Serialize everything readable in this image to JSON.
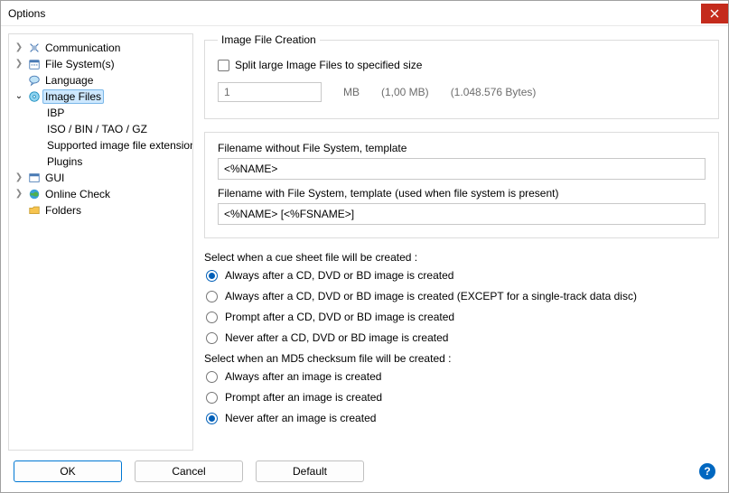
{
  "window": {
    "title": "Options"
  },
  "tree": {
    "items": [
      {
        "label": "Communication",
        "expandable": true
      },
      {
        "label": "File System(s)",
        "expandable": true
      },
      {
        "label": "Language",
        "expandable": false
      },
      {
        "label": "Image Files",
        "expandable": true,
        "open": true,
        "selected": true,
        "children": [
          {
            "label": "IBP"
          },
          {
            "label": "ISO / BIN / TAO / GZ"
          },
          {
            "label": "Supported image file extensions"
          },
          {
            "label": "Plugins"
          }
        ]
      },
      {
        "label": "GUI",
        "expandable": true
      },
      {
        "label": "Online Check",
        "expandable": true
      },
      {
        "label": "Folders",
        "expandable": false
      }
    ]
  },
  "content": {
    "group_title": "Image File Creation",
    "split_checkbox_label": "Split large Image Files to specified size",
    "split_value": "1",
    "split_unit": "MB",
    "split_human": "(1,00 MB)",
    "split_bytes": "(1.048.576 Bytes)",
    "filename_nofs_label": "Filename without File System, template",
    "filename_nofs_value": "<%NAME>",
    "filename_fs_label": "Filename with File System, template (used when file system is present)",
    "filename_fs_value": "<%NAME> [<%FSNAME>]",
    "cue_section_label": "Select when a cue sheet file will be created :",
    "cue_options": [
      "Always after a CD, DVD or BD image is created",
      "Always after a CD, DVD or BD image is created (EXCEPT for a single-track data disc)",
      "Prompt after a CD, DVD or BD image is created",
      "Never after a CD, DVD or BD image is created"
    ],
    "cue_selected": 0,
    "md5_section_label": "Select when an MD5 checksum file will be created :",
    "md5_options": [
      "Always after an image is created",
      "Prompt after an image is created",
      "Never after an image is created"
    ],
    "md5_selected": 2
  },
  "footer": {
    "ok": "OK",
    "cancel": "Cancel",
    "default": "Default"
  }
}
